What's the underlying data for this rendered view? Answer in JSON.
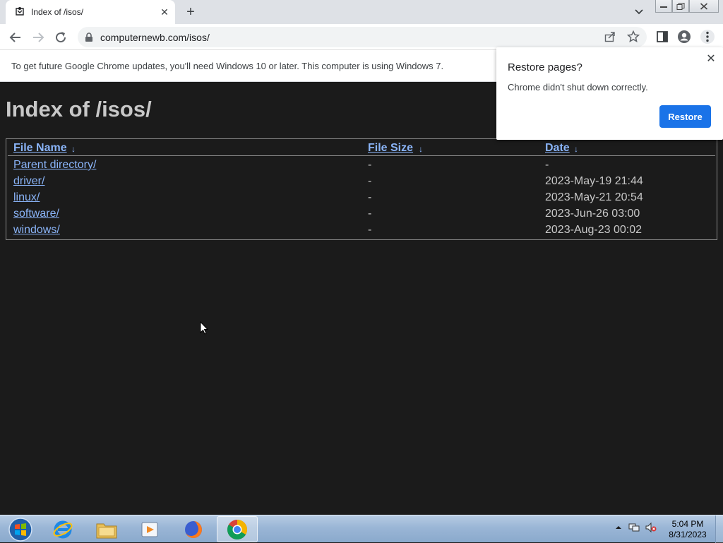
{
  "browser": {
    "tab_title": "Index of /isos/",
    "url": "computernewb.com/isos/"
  },
  "infobar": {
    "message": "To get future Google Chrome updates, you'll need Windows 10 or later. This computer is using Windows 7."
  },
  "page": {
    "heading": "Index of /isos/",
    "columns": {
      "name": "File Name",
      "size": "File Size",
      "date": "Date",
      "sort_icon": "↓"
    },
    "rows": [
      {
        "name": "Parent directory/",
        "size": "-",
        "date": "-"
      },
      {
        "name": "driver/",
        "size": "-",
        "date": "2023-May-19 21:44"
      },
      {
        "name": "linux/",
        "size": "-",
        "date": "2023-May-21 20:54"
      },
      {
        "name": "software/",
        "size": "-",
        "date": "2023-Jun-26 03:00"
      },
      {
        "name": "windows/",
        "size": "-",
        "date": "2023-Aug-23 00:02"
      }
    ]
  },
  "popup": {
    "title": "Restore pages?",
    "text": "Chrome didn't shut down correctly.",
    "button": "Restore"
  },
  "taskbar": {
    "apps": [
      "start-orb",
      "internet-explorer",
      "file-explorer",
      "media-player",
      "firefox",
      "chrome"
    ],
    "active_app": "chrome",
    "clock_time": "5:04 PM",
    "clock_date": "8/31/2023"
  },
  "colors": {
    "page_bg": "#1b1b1b",
    "link": "#8ab4f8",
    "text": "#c8c8c8",
    "accent": "#1a73e8"
  }
}
